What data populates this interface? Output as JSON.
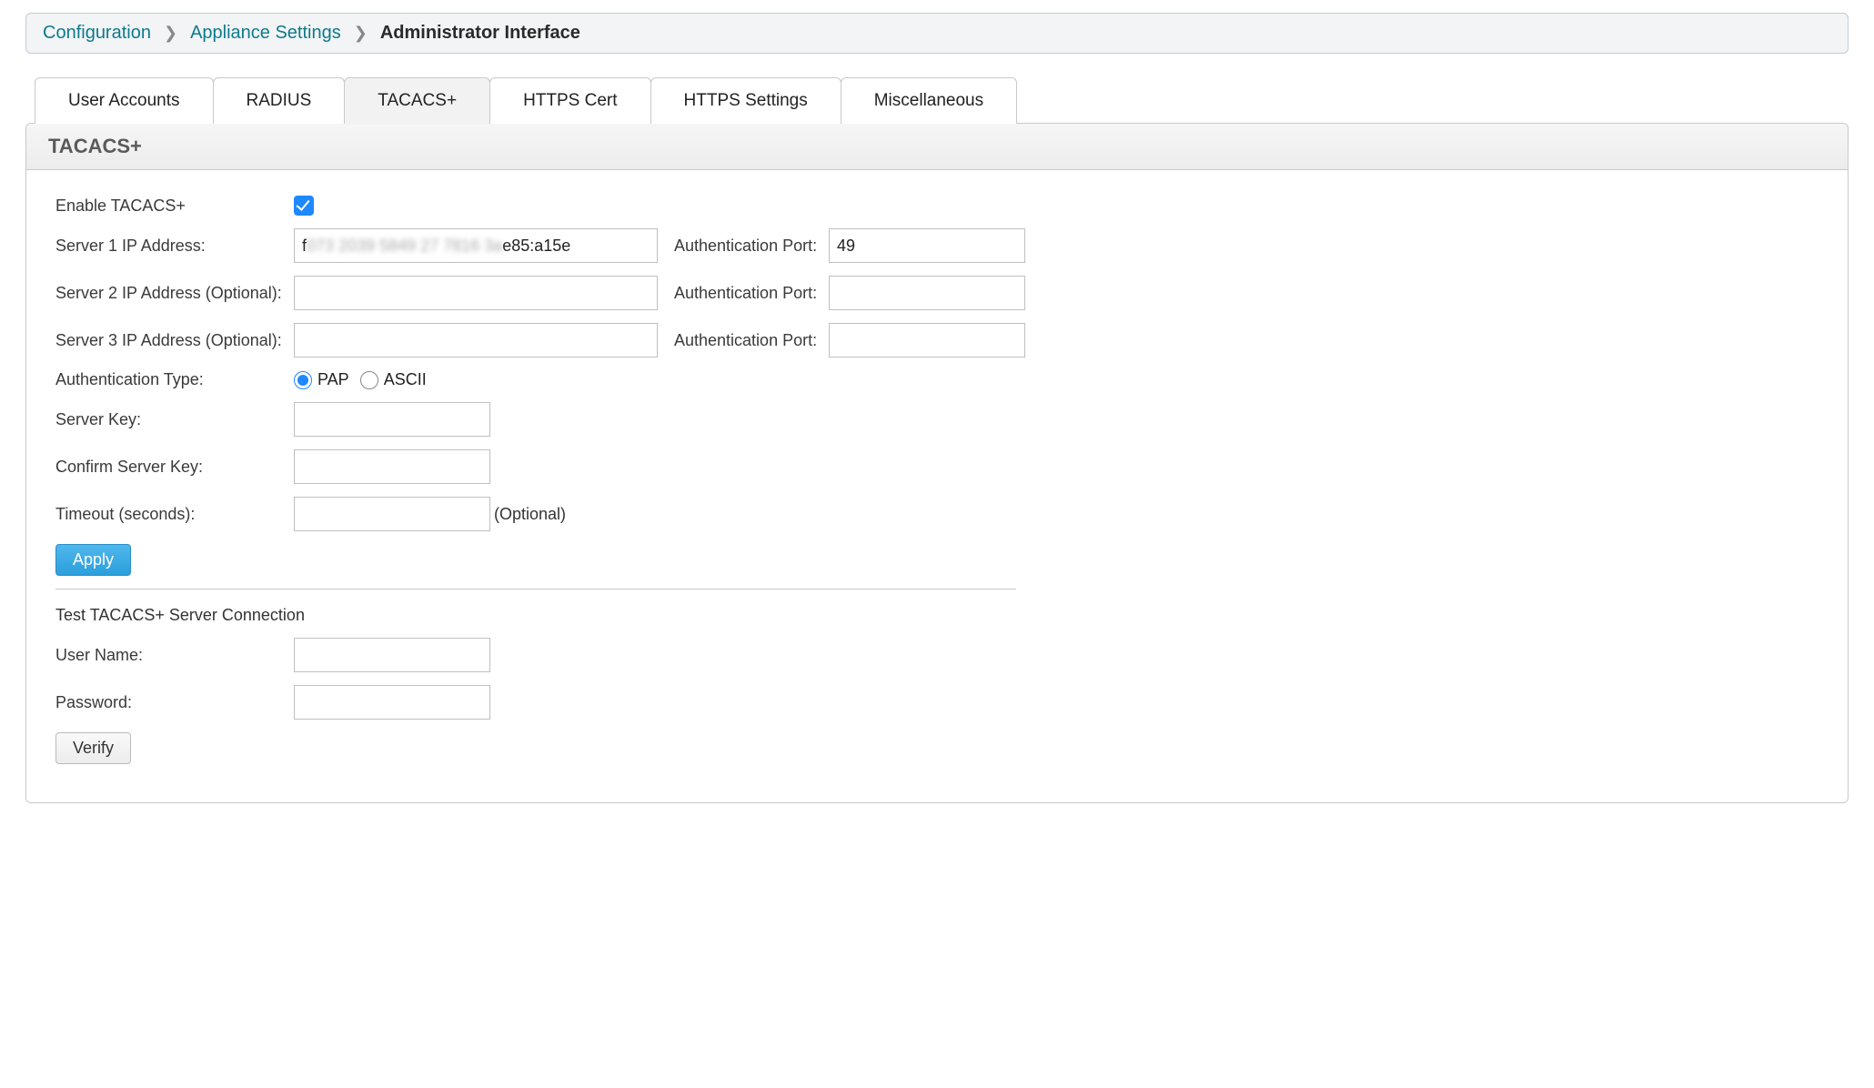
{
  "breadcrumb": {
    "items": [
      {
        "label": "Configuration",
        "link": true
      },
      {
        "label": "Appliance Settings",
        "link": true
      },
      {
        "label": "Administrator Interface",
        "link": false
      }
    ]
  },
  "tabs": [
    {
      "label": "User Accounts",
      "active": false
    },
    {
      "label": "RADIUS",
      "active": false
    },
    {
      "label": "TACACS+",
      "active": true
    },
    {
      "label": "HTTPS Cert",
      "active": false
    },
    {
      "label": "HTTPS Settings",
      "active": false
    },
    {
      "label": "Miscellaneous",
      "active": false
    }
  ],
  "panel": {
    "title": "TACACS+"
  },
  "form": {
    "enable_label": "Enable TACACS+",
    "enable_checked": true,
    "servers": [
      {
        "ip_label": "Server 1 IP Address:",
        "ip_prefix": "f",
        "ip_redacted": "073 2039 5849 27 7816 3a",
        "ip_suffix": "e85:a15e",
        "auth_label": "Authentication Port:",
        "auth_value": "49"
      },
      {
        "ip_label": "Server 2 IP Address (Optional):",
        "ip_prefix": "",
        "ip_redacted": "",
        "ip_suffix": "",
        "auth_label": "Authentication Port:",
        "auth_value": ""
      },
      {
        "ip_label": "Server 3 IP Address (Optional):",
        "ip_prefix": "",
        "ip_redacted": "",
        "ip_suffix": "",
        "auth_label": "Authentication Port:",
        "auth_value": ""
      }
    ],
    "auth_type_label": "Authentication Type:",
    "auth_types": [
      {
        "label": "PAP",
        "checked": true
      },
      {
        "label": "ASCII",
        "checked": false
      }
    ],
    "server_key_label": "Server Key:",
    "server_key_value": "",
    "confirm_key_label": "Confirm Server Key:",
    "confirm_key_value": "",
    "timeout_label": "Timeout (seconds):",
    "timeout_value": "",
    "timeout_optional": "(Optional)",
    "apply_label": "Apply"
  },
  "test": {
    "title": "Test TACACS+ Server Connection",
    "username_label": "User Name:",
    "username_value": "",
    "password_label": "Password:",
    "password_value": "",
    "verify_label": "Verify"
  }
}
